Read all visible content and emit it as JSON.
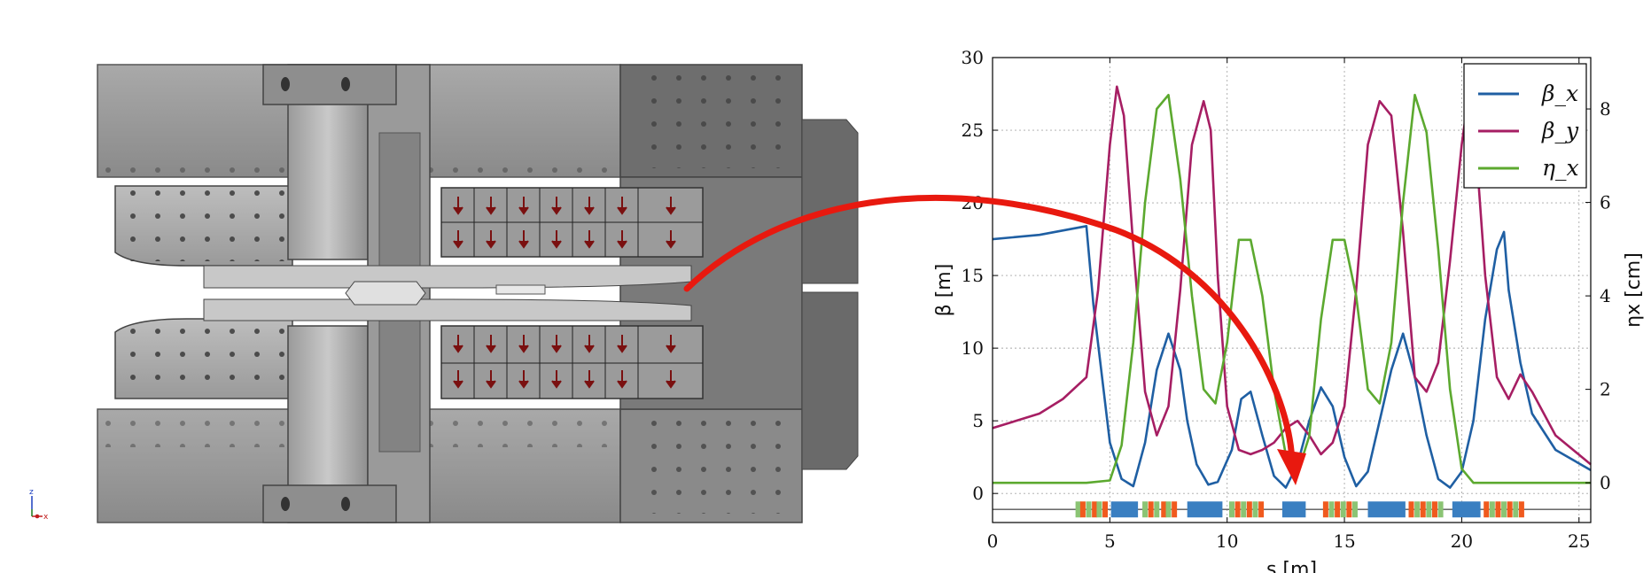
{
  "axis_indicator": {
    "z": "z",
    "x": "x"
  },
  "chart_data": {
    "type": "line",
    "xlabel": "s [m]",
    "ylabel": "β [m]",
    "y2label": "ηx [cm]",
    "xlim": [
      0,
      25.5
    ],
    "ylim": [
      -2,
      30
    ],
    "y2lim": [
      -0.85,
      9.1
    ],
    "xticks": [
      0,
      5,
      10,
      15,
      20,
      25
    ],
    "yticks": [
      0,
      5,
      10,
      15,
      20,
      25,
      30
    ],
    "y2ticks": [
      0,
      2,
      4,
      6,
      8
    ],
    "grid": true,
    "legend_position": "top-right",
    "colors": {
      "beta_x": "#1f5fa3",
      "beta_y": "#a61e63",
      "eta_x": "#5ca92f",
      "quad": "#f05a1e",
      "sext": "#8bc474",
      "dipole": "#3a7fc1"
    },
    "series": [
      {
        "name": "β_x",
        "axis": "left",
        "color": "#1f5fa3",
        "x": [
          0,
          2,
          4,
          4.3,
          5.0,
          5.5,
          6.0,
          6.5,
          7.0,
          7.5,
          8.0,
          8.3,
          8.7,
          9.2,
          9.6,
          10.2,
          10.6,
          11.0,
          11.5,
          12.0,
          12.5,
          13.0,
          13.5,
          14.0,
          14.5,
          15.0,
          15.5,
          16.0,
          16.5,
          17.0,
          17.5,
          18.0,
          18.5,
          19.0,
          19.5,
          20.0,
          20.5,
          21.0,
          21.5,
          21.8,
          22.0,
          22.5,
          23.0,
          24.0,
          25.5
        ],
        "y": [
          17.5,
          17.8,
          18.4,
          13.0,
          3.5,
          1.0,
          0.5,
          3.5,
          8.5,
          11.0,
          8.5,
          5.0,
          2.0,
          0.6,
          0.8,
          3.0,
          6.5,
          7.0,
          4.0,
          1.2,
          0.4,
          2.0,
          5.0,
          7.3,
          6.0,
          2.5,
          0.5,
          1.5,
          5.0,
          8.5,
          11.0,
          8.0,
          4.0,
          1.0,
          0.4,
          1.5,
          5.0,
          12.0,
          16.8,
          18.0,
          14.0,
          9.0,
          5.5,
          3.0,
          1.6
        ]
      },
      {
        "name": "β_y",
        "axis": "left",
        "color": "#a61e63",
        "x": [
          0,
          2,
          3,
          4,
          4.5,
          5.0,
          5.3,
          5.6,
          6.0,
          6.5,
          7.0,
          7.5,
          8.0,
          8.5,
          9.0,
          9.3,
          9.6,
          10.0,
          10.5,
          11.0,
          11.5,
          12.0,
          12.5,
          13.0,
          13.5,
          14.0,
          14.5,
          15.0,
          15.5,
          16.0,
          16.5,
          17.0,
          17.5,
          18.0,
          18.5,
          19.0,
          19.5,
          20.0,
          20.3,
          20.6,
          21.0,
          21.5,
          22.0,
          22.5,
          23.0,
          24.0,
          25.5
        ],
        "y": [
          4.5,
          5.5,
          6.5,
          8.0,
          14.0,
          24.0,
          28.0,
          26.0,
          17.0,
          7.0,
          4.0,
          6.0,
          14.0,
          24.0,
          27.0,
          25.0,
          15.0,
          6.0,
          3.0,
          2.7,
          3.0,
          3.5,
          4.5,
          5.0,
          4.0,
          2.7,
          3.5,
          6.0,
          14.0,
          24.0,
          27.0,
          26.0,
          18.0,
          8.0,
          7.0,
          9.0,
          16.0,
          24.0,
          27.5,
          24.0,
          15.0,
          8.0,
          6.5,
          8.2,
          7.0,
          4.0,
          2.0
        ]
      },
      {
        "name": "η_x",
        "axis": "right",
        "color": "#5ca92f",
        "x": [
          0,
          4,
          5.0,
          5.5,
          6.0,
          6.5,
          7.0,
          7.5,
          8.0,
          8.5,
          9.0,
          9.5,
          10.0,
          10.5,
          11.0,
          11.5,
          12.0,
          12.5,
          13.0,
          13.5,
          14.0,
          14.5,
          15.0,
          15.5,
          16.0,
          16.5,
          17.0,
          17.5,
          18.0,
          18.5,
          19.0,
          19.5,
          20.0,
          20.5,
          25.5
        ],
        "y": [
          0,
          0,
          0.05,
          0.8,
          3.0,
          6.0,
          8.0,
          8.3,
          6.5,
          4.0,
          2.0,
          1.7,
          3.0,
          5.2,
          5.2,
          4.0,
          2.0,
          0.6,
          0.2,
          1.0,
          3.5,
          5.2,
          5.2,
          4.0,
          2.0,
          1.7,
          3.0,
          6.0,
          8.3,
          7.5,
          5.0,
          2.0,
          0.3,
          0,
          0
        ]
      }
    ],
    "lattice": [
      {
        "type": "sext",
        "s": 3.65
      },
      {
        "type": "quad",
        "s": 3.85
      },
      {
        "type": "sext",
        "s": 4.1
      },
      {
        "type": "quad",
        "s": 4.35
      },
      {
        "type": "sext",
        "s": 4.55
      },
      {
        "type": "quad",
        "s": 4.8
      },
      {
        "type": "dipole",
        "s0": 5.05,
        "s1": 6.2
      },
      {
        "type": "sext",
        "s": 6.5
      },
      {
        "type": "quad",
        "s": 6.75
      },
      {
        "type": "sext",
        "s": 7.0
      },
      {
        "type": "quad",
        "s": 7.3
      },
      {
        "type": "sext",
        "s": 7.5
      },
      {
        "type": "quad",
        "s": 7.75
      },
      {
        "type": "dipole",
        "s0": 8.3,
        "s1": 9.8
      },
      {
        "type": "sext",
        "s": 10.2
      },
      {
        "type": "quad",
        "s": 10.45
      },
      {
        "type": "sext",
        "s": 10.7
      },
      {
        "type": "quad",
        "s": 10.95
      },
      {
        "type": "sext",
        "s": 11.2
      },
      {
        "type": "quad",
        "s": 11.45
      },
      {
        "type": "dipole",
        "s0": 12.35,
        "s1": 13.35
      },
      {
        "type": "quad",
        "s": 14.2
      },
      {
        "type": "sext",
        "s": 14.45
      },
      {
        "type": "quad",
        "s": 14.7
      },
      {
        "type": "sext",
        "s": 14.95
      },
      {
        "type": "quad",
        "s": 15.2
      },
      {
        "type": "sext",
        "s": 15.45
      },
      {
        "type": "dipole",
        "s0": 16.0,
        "s1": 17.6
      },
      {
        "type": "quad",
        "s": 17.85
      },
      {
        "type": "sext",
        "s": 18.1
      },
      {
        "type": "quad",
        "s": 18.35
      },
      {
        "type": "sext",
        "s": 18.6
      },
      {
        "type": "quad",
        "s": 18.85
      },
      {
        "type": "sext",
        "s": 19.1
      },
      {
        "type": "dipole",
        "s0": 19.6,
        "s1": 20.8
      },
      {
        "type": "quad",
        "s": 21.05
      },
      {
        "type": "sext",
        "s": 21.3
      },
      {
        "type": "quad",
        "s": 21.55
      },
      {
        "type": "sext",
        "s": 21.8
      },
      {
        "type": "quad",
        "s": 22.05
      },
      {
        "type": "sext",
        "s": 22.3
      },
      {
        "type": "quad",
        "s": 22.55
      }
    ]
  }
}
